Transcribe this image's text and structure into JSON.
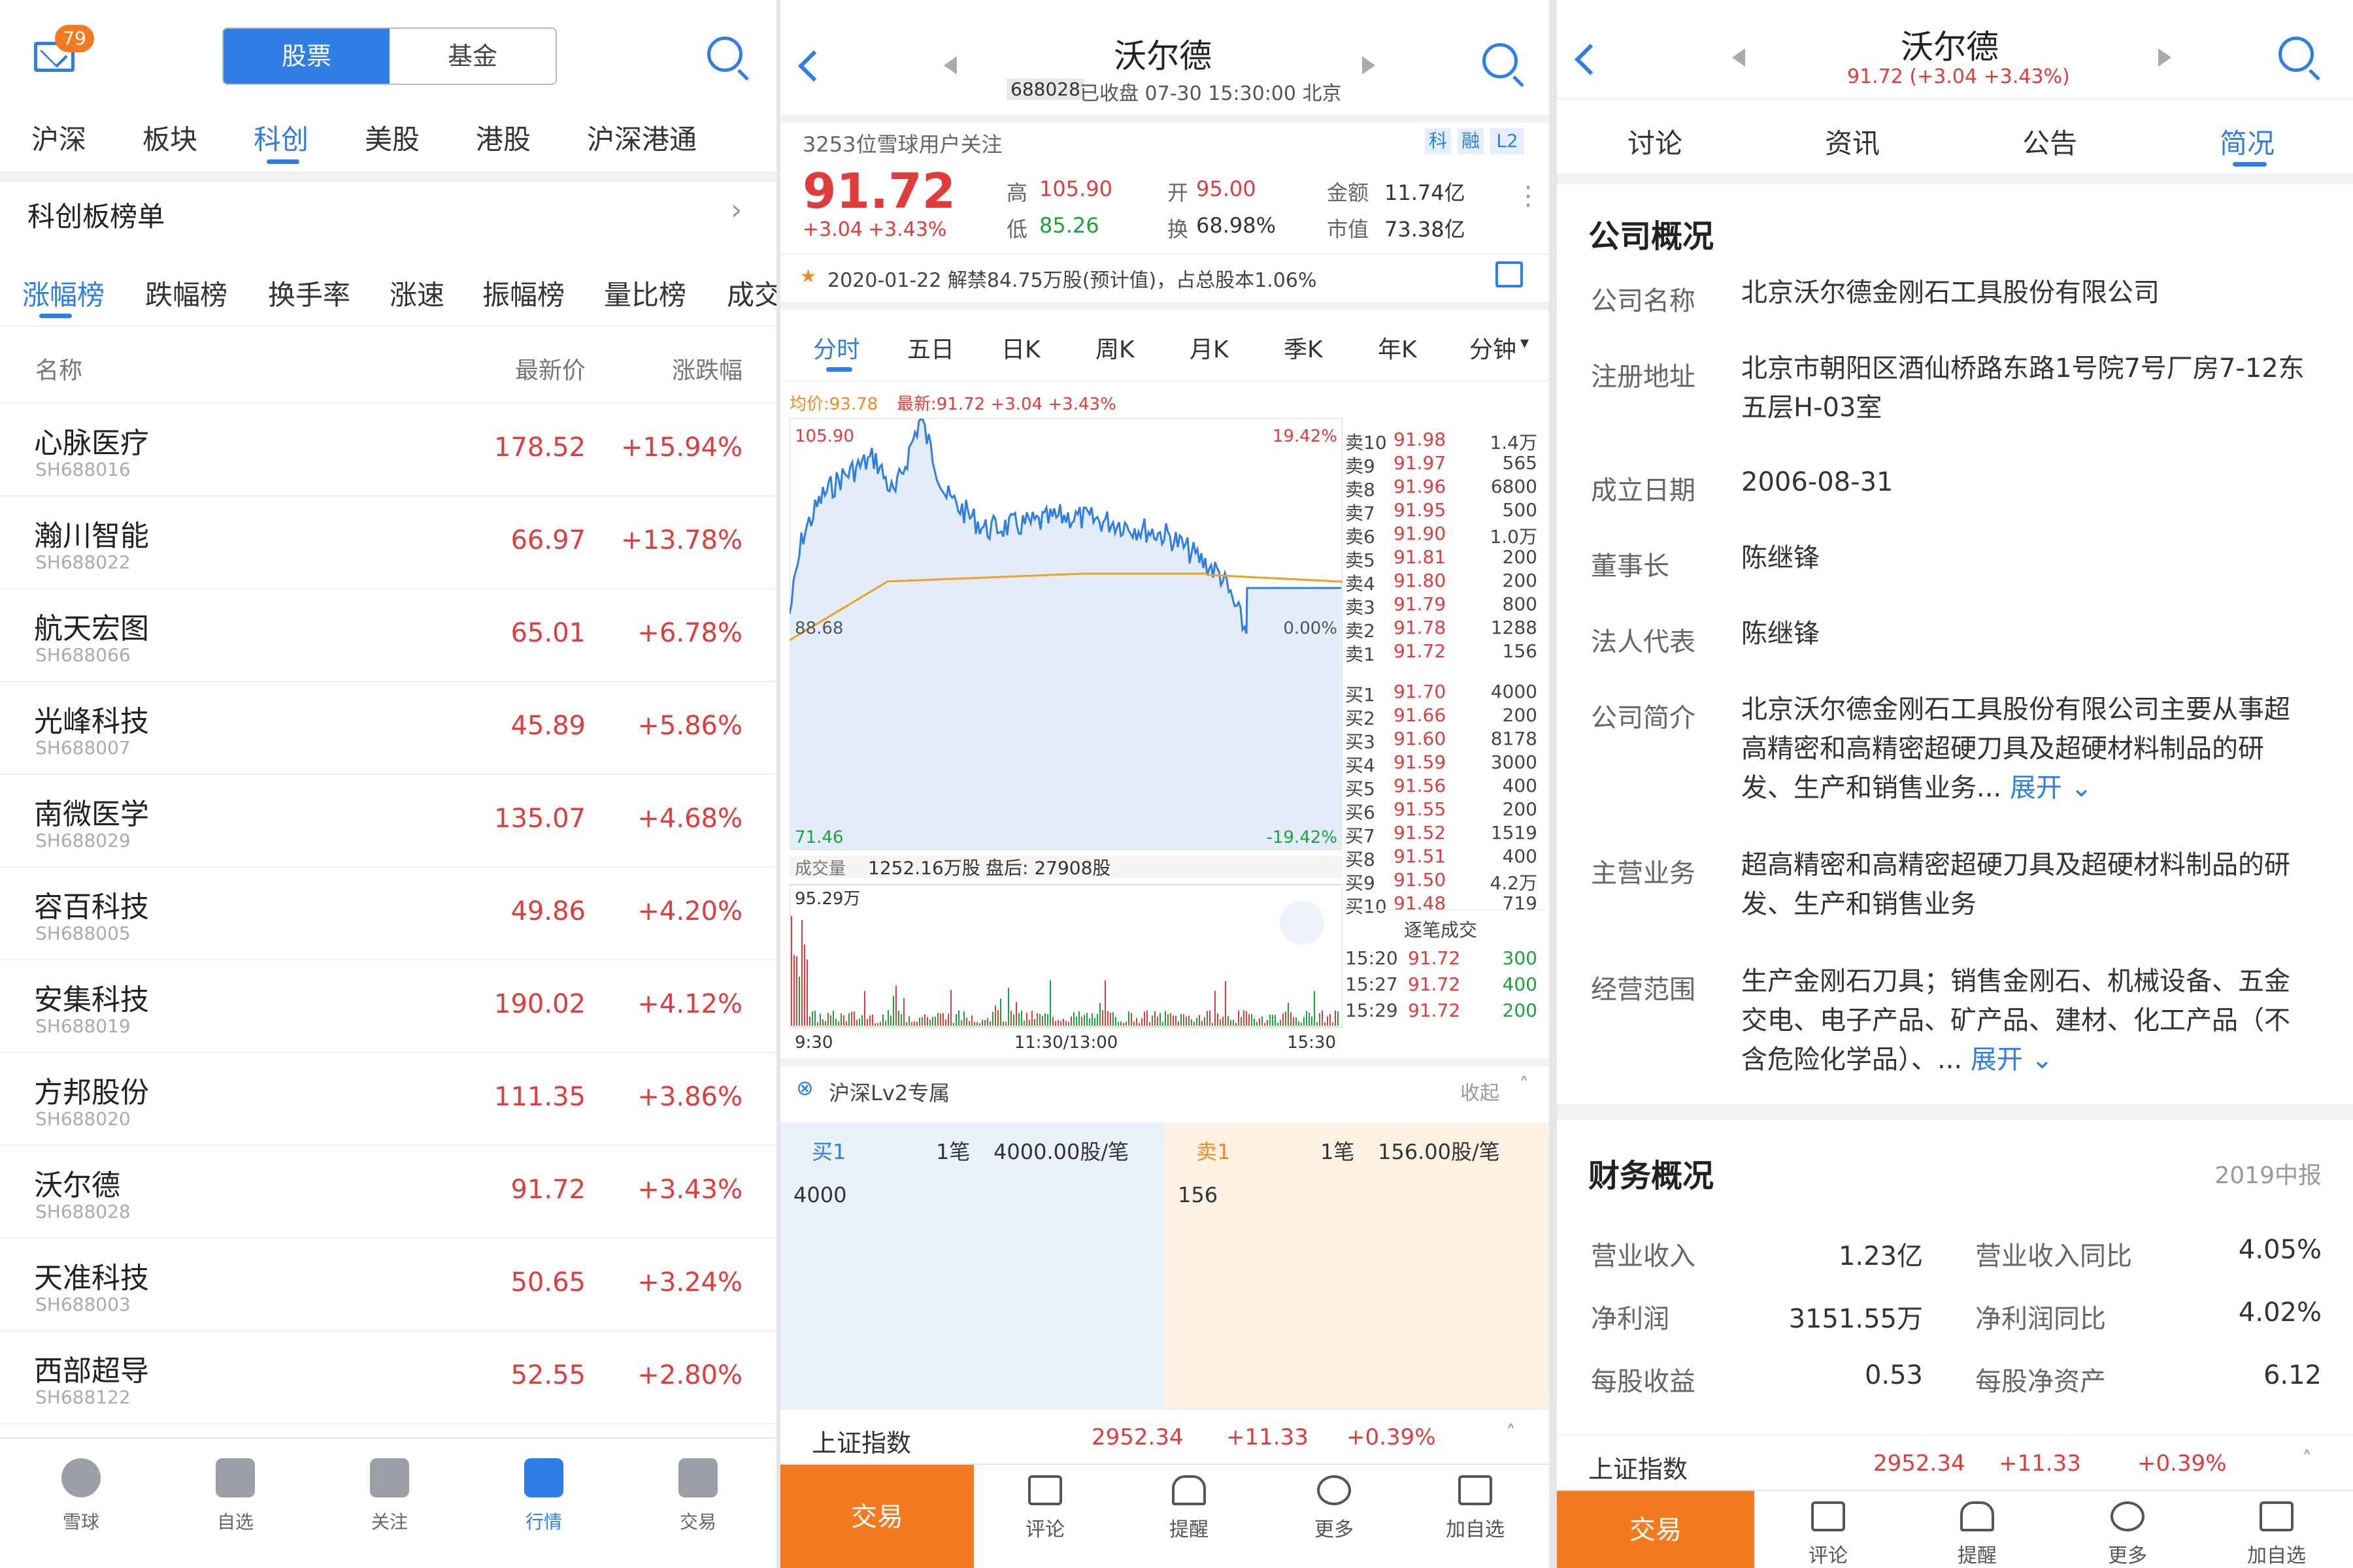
{
  "panel1": {
    "mail_badge": "79",
    "segment": {
      "stocks": "股票",
      "funds": "基金"
    },
    "market_tabs": [
      "沪深",
      "板块",
      "科创",
      "美股",
      "港股",
      "沪深港通"
    ],
    "section_title": "科创板榜单",
    "rank_tabs": [
      "涨幅榜",
      "跌幅榜",
      "换手率",
      "涨速",
      "振幅榜",
      "量比榜",
      "成交"
    ],
    "columns": {
      "name": "名称",
      "price": "最新价",
      "change": "涨跌幅"
    },
    "rows": [
      {
        "name": "心脉医疗",
        "code": "SH688016",
        "price": "178.52",
        "change": "+15.94%"
      },
      {
        "name": "瀚川智能",
        "code": "SH688022",
        "price": "66.97",
        "change": "+13.78%"
      },
      {
        "name": "航天宏图",
        "code": "SH688066",
        "price": "65.01",
        "change": "+6.78%"
      },
      {
        "name": "光峰科技",
        "code": "SH688007",
        "price": "45.89",
        "change": "+5.86%"
      },
      {
        "name": "南微医学",
        "code": "SH688029",
        "price": "135.07",
        "change": "+4.68%"
      },
      {
        "name": "容百科技",
        "code": "SH688005",
        "price": "49.86",
        "change": "+4.20%"
      },
      {
        "name": "安集科技",
        "code": "SH688019",
        "price": "190.02",
        "change": "+4.12%"
      },
      {
        "name": "方邦股份",
        "code": "SH688020",
        "price": "111.35",
        "change": "+3.86%"
      },
      {
        "name": "沃尔德",
        "code": "SH688028",
        "price": "91.72",
        "change": "+3.43%"
      },
      {
        "name": "天准科技",
        "code": "SH688003",
        "price": "50.65",
        "change": "+3.24%"
      },
      {
        "name": "西部超导",
        "code": "SH688122",
        "price": "52.55",
        "change": "+2.80%"
      }
    ],
    "bottom_nav": [
      "雪球",
      "自选",
      "关注",
      "行情",
      "交易"
    ]
  },
  "panel2": {
    "title": "沃尔德",
    "code": "688028",
    "status": "已收盘 07-30 15:30:00 北京",
    "followers": "3253位雪球用户关注",
    "tags": [
      "科",
      "融",
      "L2"
    ],
    "price": "91.72",
    "change": "+3.04",
    "change_pct": "+3.43%",
    "stats": {
      "high_label": "高",
      "high": "105.90",
      "low_label": "低",
      "low": "85.26",
      "open_label": "开",
      "open": "95.00",
      "turnover_label": "换",
      "turnover": "68.98%",
      "amount_label": "金额",
      "amount": "11.74亿",
      "mcap_label": "市值",
      "mcap": "73.38亿"
    },
    "notice": "2020-01-22  解禁84.75万股(预计值)，占总股本1.06%",
    "chart_tabs": [
      "分时",
      "五日",
      "日K",
      "周K",
      "月K",
      "季K",
      "年K",
      "分钟"
    ],
    "legend": {
      "avg": "均价:93.78",
      "latest": "最新:91.72 +3.04 +3.43%"
    },
    "axis": {
      "top_left": "105.90",
      "mid_left": "88.68",
      "bottom_left": "71.46",
      "top_right": "19.42%",
      "mid_right": "0.00%",
      "bottom_right": "-19.42%",
      "vol_top": "95.29万",
      "time": [
        "9:30",
        "11:30/13:00",
        "15:30"
      ]
    },
    "volume_line": {
      "label": "成交量",
      "value": "1252.16万股",
      "after": "盘后: 27908股"
    },
    "asks": [
      {
        "lvl": "卖10",
        "p": "91.98",
        "v": "1.4万"
      },
      {
        "lvl": "卖9",
        "p": "91.97",
        "v": "565"
      },
      {
        "lvl": "卖8",
        "p": "91.96",
        "v": "6800"
      },
      {
        "lvl": "卖7",
        "p": "91.95",
        "v": "500"
      },
      {
        "lvl": "卖6",
        "p": "91.90",
        "v": "1.0万"
      },
      {
        "lvl": "卖5",
        "p": "91.81",
        "v": "200"
      },
      {
        "lvl": "卖4",
        "p": "91.80",
        "v": "200"
      },
      {
        "lvl": "卖3",
        "p": "91.79",
        "v": "800"
      },
      {
        "lvl": "卖2",
        "p": "91.78",
        "v": "1288"
      },
      {
        "lvl": "卖1",
        "p": "91.72",
        "v": "156"
      }
    ],
    "bids": [
      {
        "lvl": "买1",
        "p": "91.70",
        "v": "4000"
      },
      {
        "lvl": "买2",
        "p": "91.66",
        "v": "200"
      },
      {
        "lvl": "买3",
        "p": "91.60",
        "v": "8178"
      },
      {
        "lvl": "买4",
        "p": "91.59",
        "v": "3000"
      },
      {
        "lvl": "买5",
        "p": "91.56",
        "v": "400"
      },
      {
        "lvl": "买6",
        "p": "91.55",
        "v": "200"
      },
      {
        "lvl": "买7",
        "p": "91.52",
        "v": "1519"
      },
      {
        "lvl": "买8",
        "p": "91.51",
        "v": "400"
      },
      {
        "lvl": "买9",
        "p": "91.50",
        "v": "4.2万"
      },
      {
        "lvl": "买10",
        "p": "91.48",
        "v": "719"
      }
    ],
    "ticks_title": "逐笔成交",
    "ticks": [
      {
        "t": "15:20",
        "p": "91.72",
        "v": "300"
      },
      {
        "t": "15:27",
        "p": "91.72",
        "v": "400"
      },
      {
        "t": "15:29",
        "p": "91.72",
        "v": "200"
      }
    ],
    "lv2": {
      "title": "沪深Lv2专属",
      "collapse": "收起"
    },
    "queue": {
      "buy_label": "买1",
      "buy_count": "1笔",
      "buy_avg": "4000.00股/笔",
      "buy_vol": "4000",
      "sell_label": "卖1",
      "sell_count": "1笔",
      "sell_avg": "156.00股/笔",
      "sell_vol": "156"
    },
    "index": {
      "name": "上证指数",
      "value": "2952.34",
      "chg": "+11.33",
      "pct": "+0.39%"
    },
    "bottom": {
      "trade": "交易",
      "items": [
        "评论",
        "提醒",
        "更多",
        "加自选"
      ]
    }
  },
  "panel3": {
    "title": "沃尔德",
    "subtitle": "91.72 (+3.04 +3.43%)",
    "tabs": [
      "讨论",
      "资讯",
      "公告",
      "简况"
    ],
    "section": "公司概况",
    "info": [
      {
        "k": "公司名称",
        "v": "北京沃尔德金刚石工具股份有限公司"
      },
      {
        "k": "注册地址",
        "v": "北京市朝阳区酒仙桥路东路1号院7号厂房7-12东五层H-03室"
      },
      {
        "k": "成立日期",
        "v": "2006-08-31"
      },
      {
        "k": "董事长",
        "v": "陈继锋"
      },
      {
        "k": "法人代表",
        "v": "陈继锋"
      },
      {
        "k": "公司简介",
        "v": "北京沃尔德金刚石工具股份有限公司主要从事超高精密和高精密超硬刀具及超硬材料制品的研发、生产和销售业务..."
      },
      {
        "k": "主营业务",
        "v": "超高精密和高精密超硬刀具及超硬材料制品的研发、生产和销售业务"
      },
      {
        "k": "经营范围",
        "v": "生产金刚石刀具；销售金刚石、机械设备、五金交电、电子产品、矿产品、建材、化工产品（不含危险化学品）、..."
      }
    ],
    "expand": "展开",
    "fin_title": "财务概况",
    "fin_period": "2019中报",
    "fin": [
      {
        "k1": "营业收入",
        "v1": "1.23亿",
        "k2": "营业收入同比",
        "v2": "4.05%"
      },
      {
        "k1": "净利润",
        "v1": "3151.55万",
        "k2": "净利润同比",
        "v2": "4.02%"
      },
      {
        "k1": "每股收益",
        "v1": "0.53",
        "k2": "每股净资产",
        "v2": "6.12"
      }
    ],
    "index": {
      "name": "上证指数",
      "value": "2952.34",
      "chg": "+11.33",
      "pct": "+0.39%"
    },
    "bottom": {
      "trade": "交易",
      "items": [
        "评论",
        "提醒",
        "更多",
        "加自选"
      ]
    }
  },
  "colors": {
    "accent": "#2f7ee6",
    "up": "#e03c3c",
    "down": "#1aa33b",
    "orange": "#f47a20",
    "avg_line": "#f0a020"
  }
}
